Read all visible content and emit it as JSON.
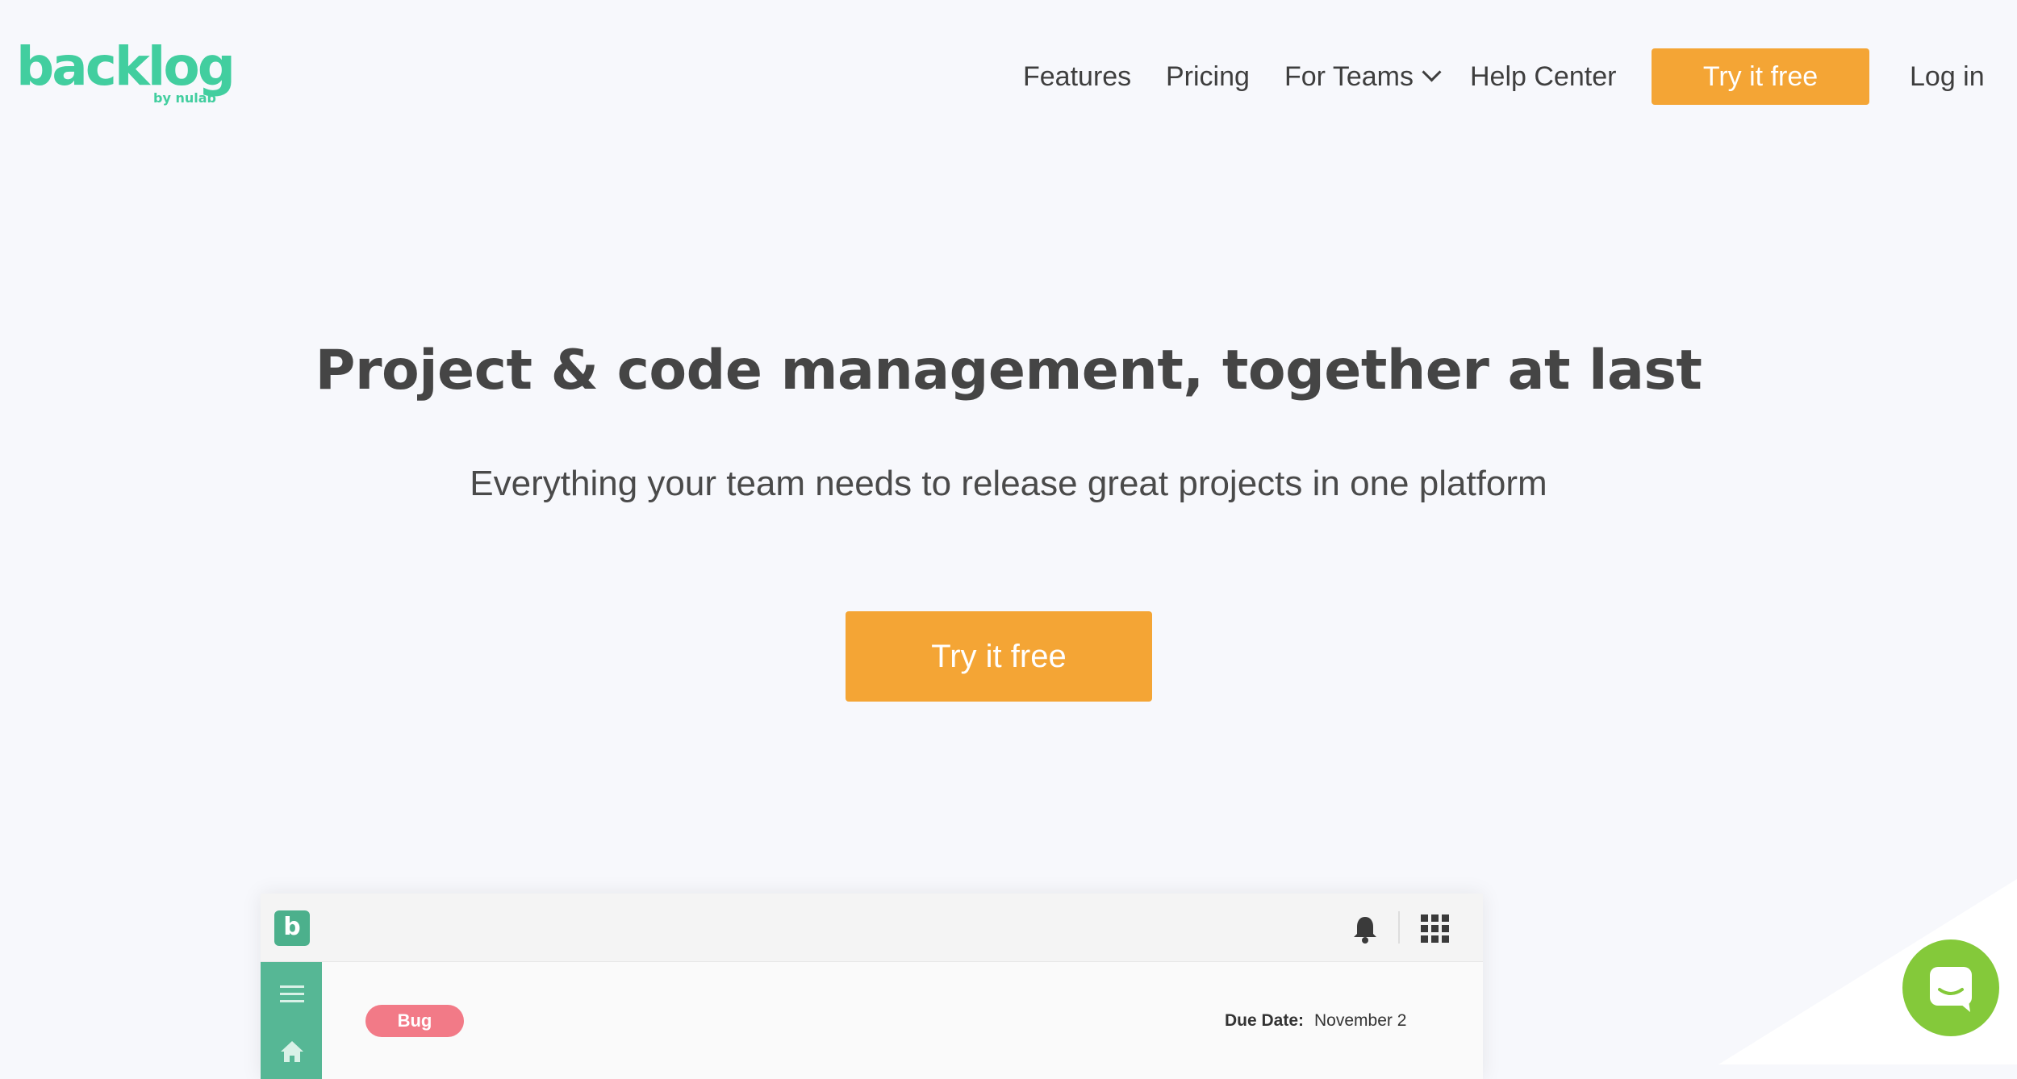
{
  "brand": {
    "logo_word": "backlog",
    "logo_sub": "by nulab",
    "accent": "#42ce9f"
  },
  "nav": {
    "features": "Features",
    "pricing": "Pricing",
    "for_teams": "For Teams",
    "help_center": "Help Center",
    "cta": "Try it free",
    "login": "Log in",
    "cta_color": "#f4a535"
  },
  "hero": {
    "title": "Project & code management, together at last",
    "subtitle": "Everything your team needs to release great projects in one platform",
    "cta": "Try it free"
  },
  "mockup": {
    "app_logo_letter": "b",
    "badge": "Bug",
    "badge_color": "#f27a87",
    "due_label": "Due Date:",
    "due_value": "November 2",
    "sidebar_color": "#56b795",
    "icons": [
      "bell-icon",
      "apps-grid-icon",
      "menu-icon",
      "home-icon"
    ]
  },
  "chat": {
    "icon": "chat-icon",
    "color": "#84c93a"
  }
}
